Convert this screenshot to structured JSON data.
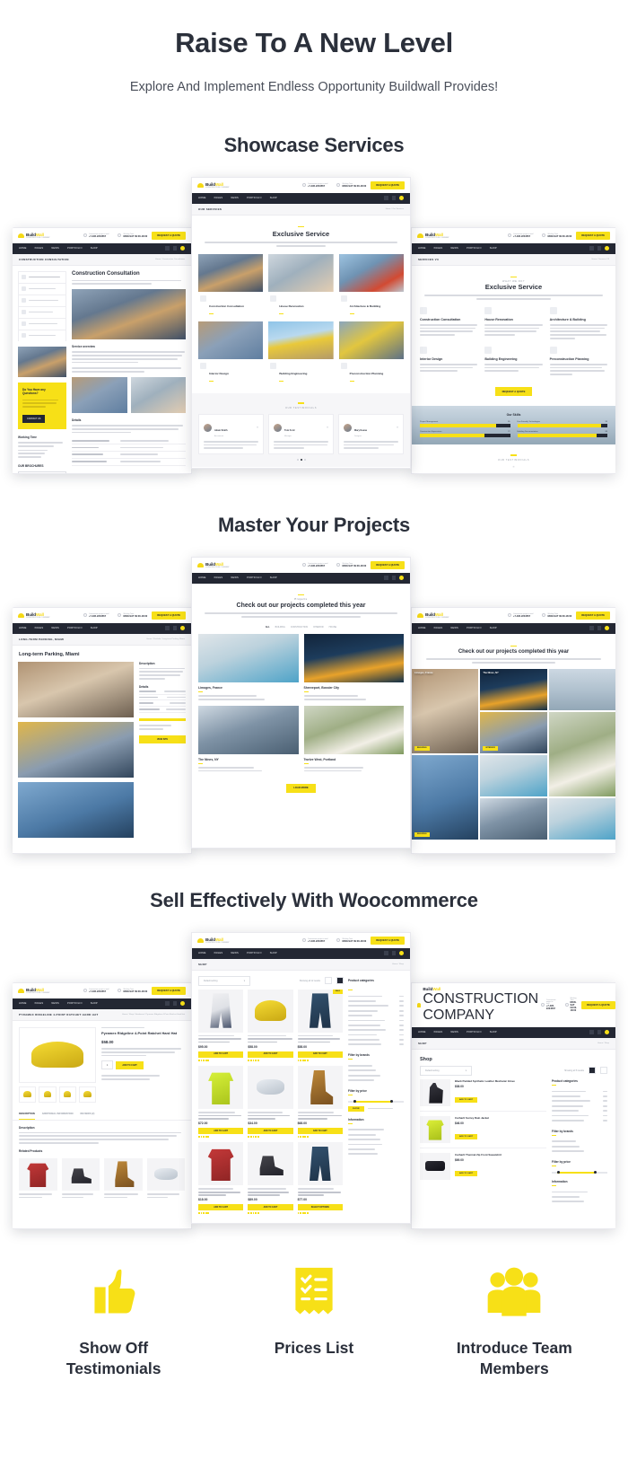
{
  "hero": {
    "title": "Raise To A New Level",
    "subtitle": "Explore And Implement Endless Opportunity Buildwall Provides!"
  },
  "sections": [
    {
      "title": "Showcase Services"
    },
    {
      "title": "Master Your Projects"
    },
    {
      "title": "Sell Effectively With Woocommerce"
    }
  ],
  "brand": {
    "name_dark": "Build",
    "name_accent": "Wall",
    "tagline": "CONSTRUCTION COMPANY",
    "accent_color": "#F7E017",
    "dark_color": "#232733"
  },
  "browser_chrome": {
    "contacts": [
      {
        "label": "Construction project e-mail",
        "value": "+7-495-2234567"
      },
      {
        "label": "Working Time",
        "value": "MON-SAT 09:00-18:00"
      }
    ],
    "cta": "REQUEST A QUOTE",
    "nav": [
      "HOME",
      "PAGES",
      "NEWS",
      "PORTFOLIO",
      "SHOP"
    ],
    "search_icon": "search-icon",
    "cart_icon": "cart-icon"
  },
  "services_page": {
    "breadcrumb": "OUR SERVICES",
    "breadcrumb_path": "Home / Our Services",
    "kicker": "",
    "heading": "Exclusive Service",
    "intro": "We provide all kinds of construction and building services and we are always glad to assure construction and unique tasks. We always take challenges and bring them to a conclusion.",
    "services": [
      {
        "name": "Construction Consultation",
        "photo": "ph-workers"
      },
      {
        "name": "House Renovation",
        "photo": "ph-reno"
      },
      {
        "name": "Architecture & Building",
        "photo": "ph-arch"
      },
      {
        "name": "Interior Design",
        "photo": "ph-interior"
      },
      {
        "name": "Building Engineering",
        "photo": "ph-excav"
      },
      {
        "name": "Preconstruction Planning",
        "photo": "ph-precon"
      }
    ],
    "testimonials_title": "OUR TESTIMONIALS",
    "testimonials": [
      {
        "name": "Adam Smith",
        "role": "Accountant",
        "quote": "Their reputation is on the highest level and their portfolio speaks for itself. Services is a team of the trusted people."
      },
      {
        "name": "Tom Ford",
        "role": "Manager",
        "quote": "I selected Services among other companies because of good recommendations I've heard. Their reputation is on the highest level and."
      },
      {
        "name": "Mary Keene",
        "role": "Designer",
        "quote": "Working with Services is a pleasure — working with high value professionals, always a pleasure — the companies passion and."
      }
    ]
  },
  "service_detail_page": {
    "breadcrumb": "CONSTRUCTION CONSULTATION",
    "breadcrumb_path": "Home / Construction Consultation",
    "heading": "Construction Consultation",
    "intro": "We will have a meeting with one of our consultants and discuss all the details regarding your future project. He will answer all your questions and tell how to start.",
    "sidebar_services": [
      "Construction Consultation",
      "House Renovation",
      "Architecture & Building",
      "Interior Design",
      "Building Engineering",
      "Preconstruction Planning"
    ],
    "question_box": {
      "title": "Do You Have any Questions?",
      "text": "Contact our experienced team and you will get the information you need.",
      "button": "CONTACT US"
    },
    "working_time_title": "Working Time",
    "working_time": [
      "Mon-Fri: 09:00-18:00",
      "Sat: 09:00-14:00",
      "Sun: Closed"
    ],
    "brochures_title": "OUR BROCHURES",
    "brochures": [
      "Company Brochure",
      "Media Kit"
    ],
    "overview_title": "Service overview",
    "overview_text": "Get your construction work done with our professional consulting team, building and development details together, we help you to plan the right approach to analyse and apply the best solutions to your large project.",
    "details_title": "Details",
    "detail_rows": [
      {
        "label": "Construction Advance",
        "value": "Planning the way construction starts"
      },
      {
        "label": "Cost Analysis",
        "value": "Choosing efficiency and low"
      },
      {
        "label": "Risk Management",
        "value": "Preventing possible risks"
      },
      {
        "label": "Planning & Scheduling",
        "value": "Construction plan on time"
      }
    ]
  },
  "services_v3_page": {
    "breadcrumb": "SERVICES V3",
    "breadcrumb_path": "Home / Services V3",
    "kicker": "WHAT WE DO?",
    "heading": "Exclusive Service",
    "intro": "We provide all kinds of construction and building services and we are always glad to assure construction and unique tasks. We always take challenges and bring them to a conclusion.",
    "features": [
      {
        "name": "Construction Consultation",
        "text": "Our company consulting with one of our consultants and discuss all the details regarding your future project. He will answer all your questions and tell how to start."
      },
      {
        "name": "House Renovation",
        "text": "Whether you want a new look for your home or want to renovate the whole house, we do that with high quality materials and experienced builders."
      },
      {
        "name": "Architecture & Building",
        "text": "Complete architectural design and a plan for your future project. Our team takes care of the building process and delivers results on time."
      },
      {
        "name": "Interior Design",
        "text": "Your home and office space be transformed to your dreams. We create spaces that are beautiful and comfortable for every client."
      },
      {
        "name": "Building Engineering",
        "text": "Our building engineering team delivers a complete design. They fit the course of analysis, calculations and all the resources."
      },
      {
        "name": "Preconstruction Planning",
        "text": "Successful projects start with the right planning. We provide plans and time budget to be as useful as possible."
      }
    ],
    "button": "REQUEST A QUOTE",
    "skills_title": "Our Skills",
    "skills": [
      {
        "name": "Project Management",
        "value": 85
      },
      {
        "name": "Eco-Friendly Technologies",
        "value": 93
      },
      {
        "name": "Construction Supervision",
        "value": 72
      },
      {
        "name": "Building Documentation",
        "value": 88
      }
    ],
    "testimonials_title": "OUR TESTIMONIALS",
    "testimonial_quote": "Their reputation is on the highest level and their portfolio speaks for itself. Services is a team of the trusted people who helped me out. I am completely satisfied with my project, I selected Services among other companies."
  },
  "projects_page": {
    "kicker": "Projects",
    "heading": "Check out our projects completed this year",
    "intro": "Every step we work on different regions all over the world. During our history we have created hundreds of buildings and have provided many construction services. Below are our best projects of 2017.",
    "filters": [
      "ALL",
      "BUILDING",
      "CONSTRUCTION",
      "INTERIOR",
      "HOUSE"
    ],
    "projects": [
      {
        "name": "Limoges, France",
        "meta1": "Client: Bellina Lockhart",
        "meta2": "Location: 2854 Jim Rosa Lane",
        "photo": "ph-pool"
      },
      {
        "name": "Shreveport, Bossier City",
        "meta1": "Client: Chip Hammond",
        "meta2": "Location: 3059 Joy Street",
        "photo": "ph-night"
      },
      {
        "name": "The Nines, NY",
        "meta1": "Client: Whitney Gaines",
        "meta2": "Location: 1232 Hartway Street",
        "photo": "ph-house"
      },
      {
        "name": "Twelve West, Portland",
        "meta1": "Client: Dudley Mcdaniel",
        "meta2": "Location: 4396 Stoney Lonesome",
        "photo": "ph-villa"
      }
    ],
    "load_more": "LOAD MORE"
  },
  "project_detail_page": {
    "breadcrumb": "LONG-TERM PARKING, MIAMI",
    "breadcrumb_path": "Home / Portfolio / Long-term Parking, Miami",
    "heading": "Long-term Parking, Miami",
    "description_title": "Description",
    "description": "Our company completed this large project on time and on budget. The building fits perfectly into the environment and serves thousands of visitors every day.",
    "details_title": "Details",
    "detail_rows": [
      {
        "label": "Client",
        "value": "Bellina Lockhart"
      },
      {
        "label": "Location",
        "value": "Miami, FL"
      },
      {
        "label": "Year",
        "value": "2017"
      },
      {
        "label": "Category",
        "value": "Construction"
      }
    ],
    "project_value_title": "Project value",
    "button": "VIEW SITE"
  },
  "portfolio_grid_page": {
    "heading": "Check out our projects completed this year",
    "intro": "Every step we work on different regions all over the world. During our history we have created hundreds of buildings.",
    "tiles": [
      {
        "label": "Limoges, France",
        "tag": "BUILDING",
        "photo": "ph-lobby"
      },
      {
        "label": "The Nines, NY",
        "tag": "HOUSE",
        "photo": "ph-night"
      },
      {
        "label": "",
        "tag": "",
        "photo": "ph-crane"
      },
      {
        "label": "",
        "tag": "INTERIOR",
        "photo": "ph-apt"
      },
      {
        "label": "",
        "tag": "",
        "photo": "ph-villa"
      },
      {
        "label": "",
        "tag": "BUILDING",
        "photo": "ph-blue"
      },
      {
        "label": "",
        "tag": "",
        "photo": "ph-pool"
      },
      {
        "label": "",
        "tag": "",
        "photo": "ph-house"
      }
    ]
  },
  "shop_page": {
    "breadcrumb": "SHOP",
    "breadcrumb_path": "Home / Shop",
    "heading": "Shop",
    "sort_label": "Default sorting",
    "results_count": "Showing all 12 results",
    "products": [
      {
        "cat": "CLOTHING, WORKWEAR",
        "name": "Pioneer Ultra Cotton Reinforced Pant",
        "price": "$95.00",
        "img": "pi-pants",
        "sale": false,
        "button": "ADD TO CART"
      },
      {
        "cat": "HEADWEAR, PROTECTION",
        "name": "Pyramex Ridgeline 4-Point Ratchet Hard Hat",
        "price": "$58.00",
        "img": "pi-hat",
        "sale": false,
        "button": "ADD TO CART"
      },
      {
        "cat": "CLOTHING, WORKWEAR",
        "name": "Wrangler Riggs Workwear Denim Work Jean",
        "price": "$58.00",
        "img": "pi-jeans",
        "sale": true,
        "sale_label": "SALE",
        "button": "ADD TO CART"
      },
      {
        "cat": "SAFETY, VISIBILITY",
        "name": "Ergodyne GloWear Hi-Vis Class 2 Safety Vest",
        "price": "$72.00",
        "img": "pi-vest",
        "sale": false,
        "button": "ADD TO CART"
      },
      {
        "cat": "PROTECTION, EYEWEAR",
        "name": "3M Virtua Protective Safety Goggles",
        "price": "$34.00",
        "img": "pi-goggles",
        "sale": false,
        "button": "ADD TO CART"
      },
      {
        "cat": "FOOTWEAR, BOOTS",
        "name": "Timberland PRO Men's Pit Boss Steel Toe",
        "price": "$68.00",
        "img": "pi-boot",
        "sale": false,
        "button": "ADD TO CART"
      },
      {
        "cat": "CLOTHING, SHIRTS",
        "name": "Rugged Blue Hi-Vis Safety T-Shirt",
        "price": "$18.00",
        "img": "pi-shirt",
        "sale": false,
        "button": "ADD TO CART"
      },
      {
        "cat": "FOOTWEAR, SHOES",
        "name": "Oakland Pro Slip Resistant Work Shoe",
        "price": "$89.00",
        "img": "pi-shoe",
        "sale": false,
        "button": "ADD TO CART"
      },
      {
        "cat": "WORKWEAR, TROUSERS",
        "name": "Wrangler Men's Rugged Wear Jean",
        "price": "$77.00",
        "img": "pi-jeans",
        "sale": false,
        "button": "SELECT OPTIONS"
      }
    ],
    "sidebar": {
      "categories_title": "Product categories",
      "categories": [
        {
          "name": "Accessories",
          "count": "4"
        },
        {
          "name": "Coveralls",
          "count": "2"
        },
        {
          "name": "Gloves + Hands",
          "count": "6"
        },
        {
          "name": "Hardware",
          "count": "3"
        },
        {
          "name": "High-Vis",
          "count": "5"
        },
        {
          "name": "Knee Systems",
          "count": "2"
        },
        {
          "name": "Safety Wear",
          "count": "9"
        },
        {
          "name": "Uncategorized",
          "count": "1"
        },
        {
          "name": "Work Boots",
          "count": "7"
        },
        {
          "name": "Work Pants",
          "count": "4"
        },
        {
          "name": "Work Shirts",
          "count": "3"
        }
      ],
      "brands_title": "Filter by brands",
      "brands": [
        "Carhartt",
        "Dickies",
        "Timberland",
        "Ergodyne",
        "Pyramex"
      ],
      "price_title": "Filter by price",
      "price_range": "Price: $10 — $120",
      "filter_button": "FILTER",
      "info_title": "Information",
      "info_links": [
        "Shipping & Delivery",
        "Returns Policy",
        "Privacy Policy",
        "Terms & Conditions",
        "Size Guide",
        "Contact Us"
      ]
    }
  },
  "product_detail_page": {
    "breadcrumb": "PYRAMEX RIDGELINE 4-POINT RATCHET HARD HAT",
    "breadcrumb_path": "Home / Shop / Headwear / Pyramex Ridgeline 4-Point Ratchet Hard Hat",
    "cat": "HEADWEAR, PROTECTION",
    "name": "Pyramex Ridgeline 4-Point Ratchet Hard Hat",
    "price": "$58.00",
    "tabs": [
      "DESCRIPTION",
      "ADDITIONAL INFORMATION",
      "REVIEWS (2)"
    ],
    "description_title": "Description",
    "description": "Constructed from durable, impact-resistant ABS shell. The 4-point ratchet suspension delivers a secure, comfortable fit all day long. Meets ANSI Z89.1 Type I Class C, G and E standards.",
    "related_title": "Related Products",
    "related": [
      {
        "name": "Rugged Blue Hi-Vis Safety T-Shirt",
        "price": "$18.00",
        "img": "pi-shirt"
      },
      {
        "name": "Oakland Pro Slip Resistant Work Shoe",
        "price": "$89.00",
        "img": "pi-shoe"
      },
      {
        "name": "Timberland PRO Pit Boss Steel Toe",
        "price": "$68.00",
        "img": "pi-boot"
      },
      {
        "name": "3M Virtua Protective Safety Goggles",
        "price": "$34.00",
        "img": "pi-goggles"
      }
    ],
    "add_to_cart": "ADD TO CART"
  },
  "shop_alt_page": {
    "breadcrumb": "SHOP",
    "heading": "Shop",
    "sort_label": "Default sorting",
    "results_count": "Showing all 8 results",
    "products": [
      {
        "name": "Black Padded Synthetic Leather Mechanic Glove",
        "price": "$38.00",
        "img": "pi-glove",
        "button": "ADD TO CART"
      },
      {
        "name": "Carhartt Surrey Rain Jacket",
        "price": "$46.00",
        "img": "pi-jacket",
        "button": "ADD TO CART"
      },
      {
        "name": "Carhartt Thermal Zip Front Sweatshirt",
        "price": "$69.00",
        "img": "pi-belt",
        "button": "ADD TO CART"
      }
    ],
    "sidebar": {
      "categories_title": "Product categories",
      "brands_title": "Filter by brands",
      "price_title": "Filter by price",
      "info_title": "Information"
    }
  },
  "features": [
    {
      "icon": "thumbs-up-icon",
      "label": "Show Off\nTestimonials",
      "line1": "Show Off",
      "line2": "Testimonials"
    },
    {
      "icon": "price-list-icon",
      "label": "Prices List",
      "line1": "Prices List",
      "line2": ""
    },
    {
      "icon": "team-group-icon",
      "label": "Introduce Team\nMembers",
      "line1": "Introduce Team",
      "line2": "Members"
    }
  ]
}
